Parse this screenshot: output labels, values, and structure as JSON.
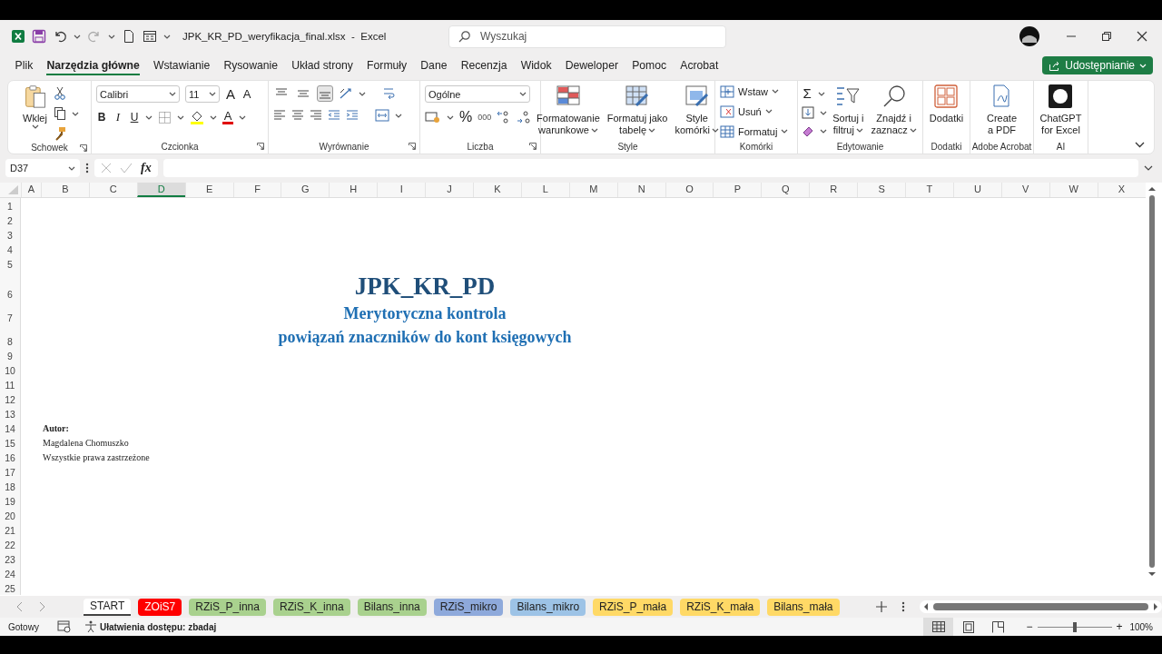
{
  "title_bar": {
    "title": "JPK_KR_PD_weryfikacja_final.xlsx  -  Excel",
    "search": {
      "placeholder": "Wyszukaj"
    }
  },
  "menu": [
    {
      "label": "Plik",
      "selected": false
    },
    {
      "label": "Narzędzia główne",
      "selected": true
    },
    {
      "label": "Wstawianie",
      "selected": false
    },
    {
      "label": "Rysowanie",
      "selected": false
    },
    {
      "label": "Układ strony",
      "selected": false
    },
    {
      "label": "Formuły",
      "selected": false
    },
    {
      "label": "Dane",
      "selected": false
    },
    {
      "label": "Recenzja",
      "selected": false
    },
    {
      "label": "Widok",
      "selected": false
    },
    {
      "label": "Deweloper",
      "selected": false
    },
    {
      "label": "Pomoc",
      "selected": false
    },
    {
      "label": "Acrobat",
      "selected": false
    }
  ],
  "share_button": "Udostępnianie",
  "ribbon": {
    "clipboard": {
      "label": "Schowek",
      "paste": "Wklej"
    },
    "font": {
      "label": "Czcionka",
      "font_name": "Calibri",
      "font_size": "11",
      "grow": "A",
      "shrink": "A",
      "bold": "B",
      "italic": "I",
      "underline": "U",
      "font_color": "A"
    },
    "alignment": {
      "label": "Wyrównanie",
      "vertical": [
        {
          "selected": false
        },
        {
          "selected": false
        },
        {
          "selected": true
        }
      ]
    },
    "number": {
      "label": "Liczba",
      "format": "Ogólne",
      "percent": "%",
      "thousands": "000"
    },
    "styles": {
      "label": "Style",
      "buttons": [
        {
          "kind": "conditional",
          "lines": [
            "Formatowanie",
            "warunkowe"
          ]
        },
        {
          "kind": "table",
          "lines": [
            "Formatuj jako",
            "tabelę"
          ]
        },
        {
          "kind": "cell_styles",
          "lines": [
            "Style",
            "komórki"
          ]
        }
      ]
    },
    "cells": {
      "label": "Komórki",
      "buttons": [
        {
          "kind": "insert",
          "label": "Wstaw"
        },
        {
          "kind": "delete",
          "label": "Usuń"
        },
        {
          "kind": "format",
          "label": "Formatuj"
        }
      ]
    },
    "editing": {
      "label": "Edytowanie",
      "sum": "Σ",
      "buttons": [
        {
          "kind": "sort",
          "lines": [
            "Sortuj i",
            "filtruj"
          ]
        },
        {
          "kind": "find",
          "lines": [
            "Znajdź i",
            "zaznacz"
          ]
        }
      ]
    },
    "addins": {
      "label": "Dodatki",
      "lines": [
        "Dodatki"
      ]
    },
    "acrobat": {
      "label": "Adobe Acrobat",
      "lines": [
        "Create",
        "a PDF"
      ]
    },
    "ai": {
      "label": "AI",
      "lines": [
        "ChatGPT",
        "for Excel"
      ]
    }
  },
  "formula_bar": {
    "name_box": "D37",
    "fx": "fx"
  },
  "columns": [
    {
      "label": "A",
      "selected": false
    },
    {
      "label": "B",
      "selected": false
    },
    {
      "label": "C",
      "selected": false
    },
    {
      "label": "D",
      "selected": true
    },
    {
      "label": "E",
      "selected": false
    },
    {
      "label": "F",
      "selected": false
    },
    {
      "label": "G",
      "selected": false
    },
    {
      "label": "H",
      "selected": false
    },
    {
      "label": "I",
      "selected": false
    },
    {
      "label": "J",
      "selected": false
    },
    {
      "label": "K",
      "selected": false
    },
    {
      "label": "L",
      "selected": false
    },
    {
      "label": "M",
      "selected": false
    },
    {
      "label": "N",
      "selected": false
    },
    {
      "label": "O",
      "selected": false
    },
    {
      "label": "P",
      "selected": false
    },
    {
      "label": "Q",
      "selected": false
    },
    {
      "label": "R",
      "selected": false
    },
    {
      "label": "S",
      "selected": false
    },
    {
      "label": "T",
      "selected": false
    },
    {
      "label": "U",
      "selected": false
    },
    {
      "label": "V",
      "selected": false
    },
    {
      "label": "W",
      "selected": false
    },
    {
      "label": "X",
      "selected": false
    }
  ],
  "rows": [
    {
      "number": "1",
      "kind": "blank"
    },
    {
      "number": "2",
      "kind": "blank"
    },
    {
      "number": "3",
      "kind": "blank"
    },
    {
      "number": "4",
      "kind": "blank"
    },
    {
      "number": "5",
      "kind": "blank"
    },
    {
      "number": "6",
      "kind": "title",
      "text": "JPK_KR_PD"
    },
    {
      "number": "7",
      "kind": "subtitle",
      "text": "Merytoryczna kontrola"
    },
    {
      "number": "8",
      "kind": "subtitle",
      "text": "powiązań znaczników do kont księgowych"
    },
    {
      "number": "9",
      "kind": "blank"
    },
    {
      "number": "10",
      "kind": "blank"
    },
    {
      "number": "11",
      "kind": "blank"
    },
    {
      "number": "12",
      "kind": "blank"
    },
    {
      "number": "13",
      "kind": "blank"
    },
    {
      "number": "14",
      "kind": "label",
      "text": "Autor:"
    },
    {
      "number": "15",
      "kind": "note",
      "text": "Magdalena Chomuszko"
    },
    {
      "number": "16",
      "kind": "note",
      "text": "Wszystkie prawa zastrzeżone"
    },
    {
      "number": "17",
      "kind": "blank"
    },
    {
      "number": "18",
      "kind": "blank"
    },
    {
      "number": "19",
      "kind": "blank"
    },
    {
      "number": "20",
      "kind": "blank"
    },
    {
      "number": "21",
      "kind": "blank"
    },
    {
      "number": "22",
      "kind": "blank"
    },
    {
      "number": "23",
      "kind": "blank"
    },
    {
      "number": "24",
      "kind": "blank"
    },
    {
      "number": "25",
      "kind": "blank"
    }
  ],
  "sheet_tabs": [
    {
      "label": "START",
      "selected": true
    },
    {
      "label": "ZOiS7",
      "selected": false,
      "color": "#ff0000"
    },
    {
      "label": "RZiS_P_inna",
      "selected": false,
      "color": "#a9d18e"
    },
    {
      "label": "RZiS_K_inna",
      "selected": false,
      "color": "#a9d18e"
    },
    {
      "label": "Bilans_inna",
      "selected": false,
      "color": "#a9d18e"
    },
    {
      "label": "RZiS_mikro",
      "selected": false,
      "color": "#8ea9db"
    },
    {
      "label": "Bilans_mikro",
      "selected": false,
      "color": "#9dc3e6"
    },
    {
      "label": "RZiS_P_mała",
      "selected": false,
      "color": "#ffd966"
    },
    {
      "label": "RZiS_K_mała",
      "selected": false,
      "color": "#ffd966"
    },
    {
      "label": "Bilans_mała",
      "selected": false,
      "color": "#ffd966"
    }
  ],
  "status_bar": {
    "status": "Gotowy",
    "accessibility": "Ułatwienia dostępu: zbadaj",
    "views": [
      {
        "kind": "normal",
        "selected": true
      },
      {
        "kind": "page_layout",
        "selected": false
      },
      {
        "kind": "page_break",
        "selected": false
      }
    ],
    "zoom_out": "−",
    "zoom_in": "+",
    "zoom": {
      "level": 0.5
    },
    "zoom_label": "100%"
  }
}
